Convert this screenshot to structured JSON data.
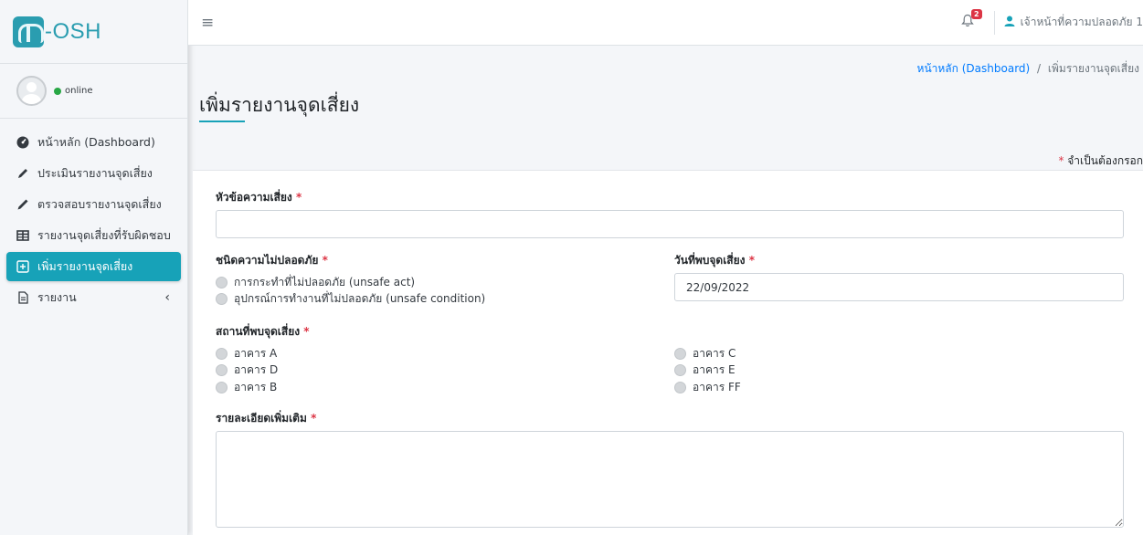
{
  "brand": {
    "name": "-OSH"
  },
  "user_panel": {
    "status": "online"
  },
  "sidebar": {
    "items": [
      {
        "label": "หน้าหลัก (Dashboard)",
        "icon": "tachometer-icon"
      },
      {
        "label": "ประเมินรายงานจุดเสี่ยง",
        "icon": "pen-icon"
      },
      {
        "label": "ตรวจสอบรายงานจุดเสี่ยง",
        "icon": "pencil-icon"
      },
      {
        "label": "รายงานจุดเสี่ยงที่รับผิดชอบ",
        "icon": "table-icon"
      },
      {
        "label": "เพิ่มรายงานจุดเสี่ยง",
        "icon": "plus-square-icon",
        "active": true
      },
      {
        "label": "รายงาน",
        "icon": "file-icon",
        "caret": "‹"
      }
    ]
  },
  "topbar": {
    "notification_count": "2",
    "user_name": "เจ้าหน้าที่ความปลอดภัย 1"
  },
  "breadcrumb": {
    "home": "หน้าหลัก (Dashboard)",
    "separator": "/",
    "current": "เพิ่มรายงานจุดเสี่ยง"
  },
  "page": {
    "title": "เพิ่มรายงานจุดเสี่ยง",
    "required_note": "จำเป็นต้องกรอก",
    "required_mark": "*"
  },
  "form": {
    "risk_title": {
      "label": "หัวข้อความเสี่ยง",
      "value": ""
    },
    "unsafe_type": {
      "label": "ชนิดความไม่ปลอดภัย",
      "options": [
        "การกระทำที่ไม่ปลอดภัย (unsafe act)",
        "อุปกรณ์การทำงานที่ไม่ปลอดภัย (unsafe condition)"
      ]
    },
    "found_date": {
      "label": "วันที่พบจุดเสี่ยง",
      "value": "22/09/2022"
    },
    "location": {
      "label": "สถานที่พบจุดเสี่ยง",
      "options_left": [
        "อาคาร A",
        "อาคาร D",
        "อาคาร B"
      ],
      "options_right": [
        "อาคาร C",
        "อาคาร E",
        "อาคาร FF"
      ]
    },
    "details": {
      "label": "รายละเอียดเพิ่มเติม",
      "value": ""
    }
  },
  "colors": {
    "accent": "#17a2b8",
    "required": "#dc3545",
    "link": "#007bff",
    "online": "#28a745"
  }
}
